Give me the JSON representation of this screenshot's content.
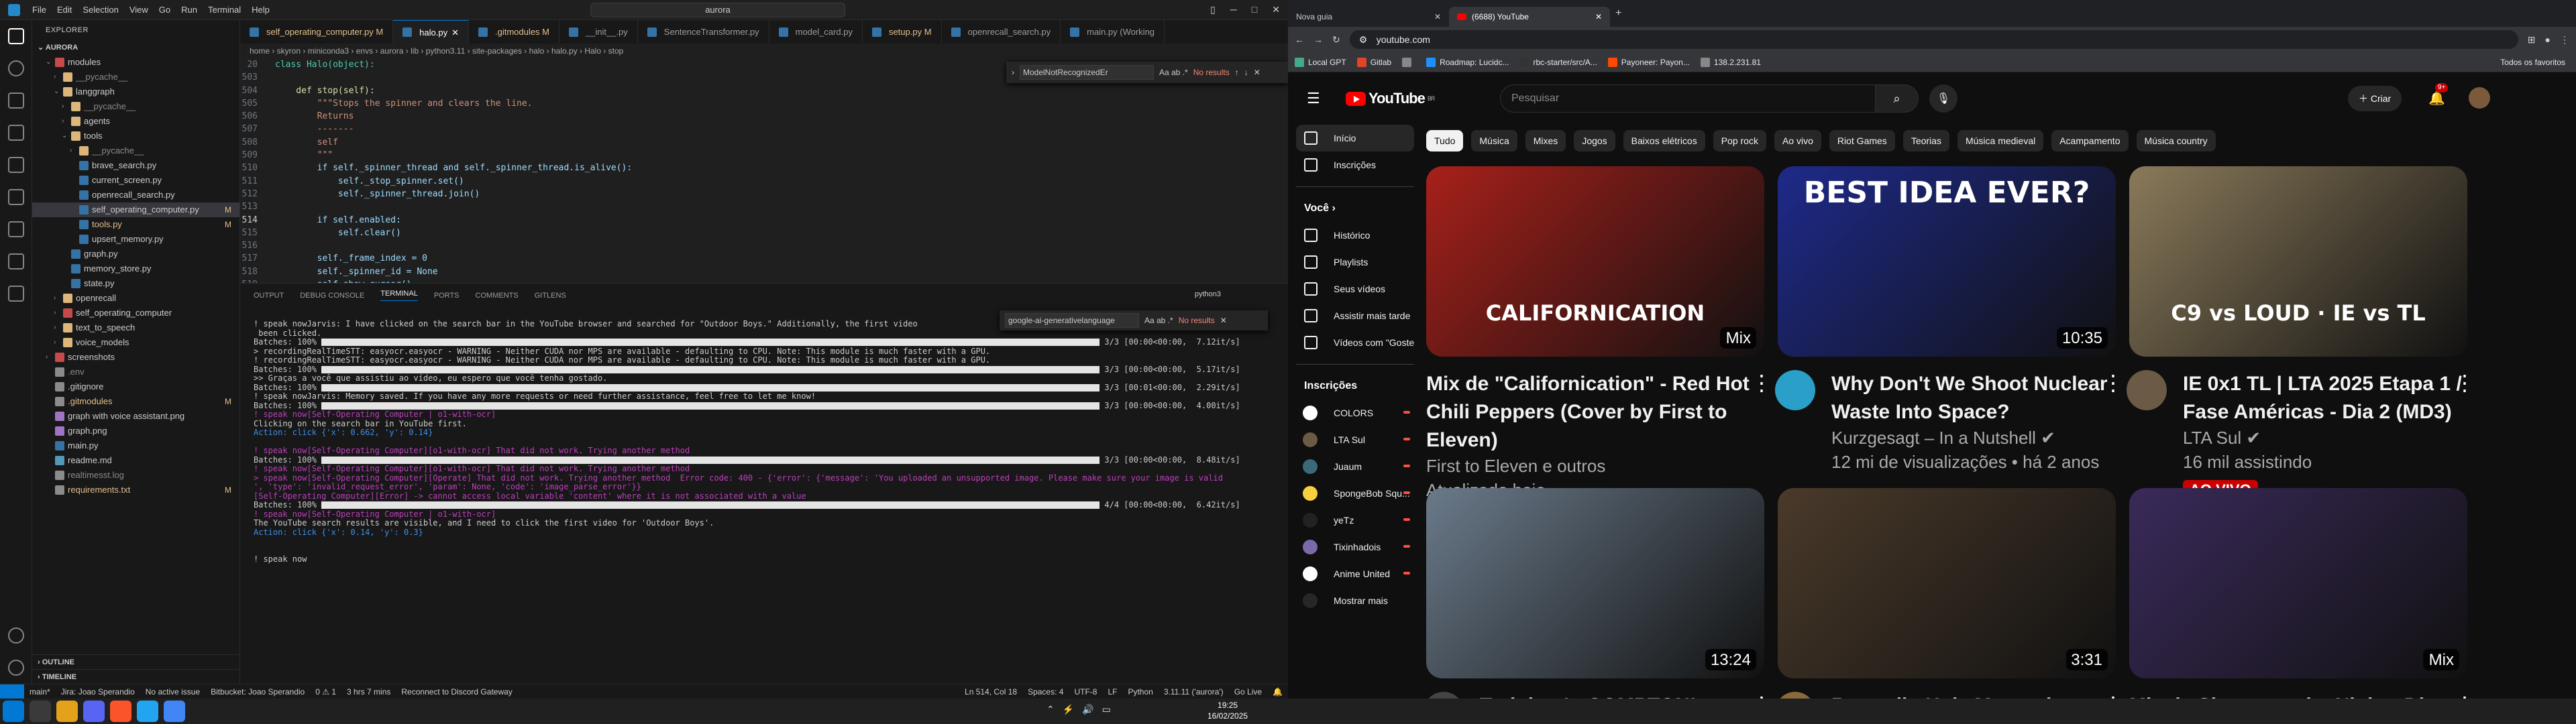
{
  "vscode": {
    "menu": [
      "File",
      "Edit",
      "Selection",
      "View",
      "Go",
      "Run",
      "Terminal",
      "Help"
    ],
    "command_center": "aurora",
    "explorer_title": "EXPLORER",
    "root": "AURORA",
    "tree": [
      {
        "label": "modules",
        "indent": 1,
        "type": "folder-open",
        "color": "red"
      },
      {
        "label": "__pycache__",
        "indent": 2,
        "type": "folder",
        "dim": true
      },
      {
        "label": "langgraph",
        "indent": 2,
        "type": "folder-open"
      },
      {
        "label": "__pycache__",
        "indent": 3,
        "type": "folder",
        "dim": true
      },
      {
        "label": "agents",
        "indent": 3,
        "type": "folder"
      },
      {
        "label": "tools",
        "indent": 3,
        "type": "folder-open"
      },
      {
        "label": "__pycache__",
        "indent": 4,
        "type": "folder",
        "dim": true
      },
      {
        "label": "brave_search.py",
        "indent": 4,
        "type": "py"
      },
      {
        "label": "current_screen.py",
        "indent": 4,
        "type": "py"
      },
      {
        "label": "openrecall_search.py",
        "indent": 4,
        "type": "py"
      },
      {
        "label": "self_operating_computer.py",
        "indent": 4,
        "type": "py",
        "sel": true,
        "mark": "M"
      },
      {
        "label": "tools.py",
        "indent": 4,
        "type": "py",
        "mod": true,
        "mark": "M"
      },
      {
        "label": "upsert_memory.py",
        "indent": 4,
        "type": "py"
      },
      {
        "label": "graph.py",
        "indent": 3,
        "type": "py"
      },
      {
        "label": "memory_store.py",
        "indent": 3,
        "type": "py"
      },
      {
        "label": "state.py",
        "indent": 3,
        "type": "py"
      },
      {
        "label": "openrecall",
        "indent": 2,
        "type": "folder"
      },
      {
        "label": "self_operating_computer",
        "indent": 2,
        "type": "folder",
        "color": "red"
      },
      {
        "label": "text_to_speech",
        "indent": 2,
        "type": "folder"
      },
      {
        "label": "voice_models",
        "indent": 2,
        "type": "folder"
      },
      {
        "label": "screenshots",
        "indent": 1,
        "type": "folder",
        "color": "red"
      },
      {
        "label": ".env",
        "indent": 1,
        "type": "file",
        "dim": true
      },
      {
        "label": ".gitignore",
        "indent": 1,
        "type": "file"
      },
      {
        "label": ".gitmodules",
        "indent": 1,
        "type": "file",
        "mod": true,
        "mark": "M"
      },
      {
        "label": "graph with voice assistant.png",
        "indent": 1,
        "type": "img"
      },
      {
        "label": "graph.png",
        "indent": 1,
        "type": "img"
      },
      {
        "label": "main.py",
        "indent": 1,
        "type": "py"
      },
      {
        "label": "readme.md",
        "indent": 1,
        "type": "md"
      },
      {
        "label": "realtimesst.log",
        "indent": 1,
        "type": "file",
        "dim": true
      },
      {
        "label": "requirements.txt",
        "indent": 1,
        "type": "file",
        "mod": true,
        "mark": "M"
      }
    ],
    "outline": "OUTLINE",
    "timeline": "TIMELINE",
    "tabs": [
      {
        "label": "self_operating_computer.py M",
        "mod": true
      },
      {
        "label": "halo.py",
        "active": true
      },
      {
        "label": ".gitmodules M",
        "mod": true
      },
      {
        "label": "__init__.py"
      },
      {
        "label": "SentenceTransformer.py"
      },
      {
        "label": "model_card.py"
      },
      {
        "label": "setup.py M",
        "mod": true
      },
      {
        "label": "openrecall_search.py"
      },
      {
        "label": "main.py (Working"
      }
    ],
    "breadcrumb": "home › skyron › miniconda3 › envs › aurora › lib › python3.11 › site-packages › halo › halo.py › Halo › stop",
    "find_value": "ModelNotRecognizedEr",
    "find_result": "No results",
    "term_find_value": "google-ai-generativelanguage",
    "term_find_result": "No results",
    "panel_tabs": [
      "OUTPUT",
      "DEBUG CONSOLE",
      "TERMINAL",
      "PORTS",
      "COMMENTS",
      "GITLENS"
    ],
    "terminal_shell": "python3",
    "status": {
      "branch": "main*",
      "jira": "Jira: Joao Sperandio",
      "issue": "No active issue",
      "bitbucket": "Bitbucket: Joao Sperandio",
      "problems": "0 ⚠ 1",
      "time": "3 hrs 7 mins",
      "discord": "Reconnect to Discord Gateway",
      "position": "Ln 514, Col 18",
      "spaces": "Spaces: 4",
      "encoding": "UTF-8",
      "eol": "LF",
      "lang": "Python",
      "interpreter": "3.11.11 ('aurora')",
      "golive": "Go Live"
    }
  },
  "code": [
    {
      "n": "20",
      "t": "class Halo(object):",
      "k": "cls"
    },
    {
      "n": "503",
      "t": ""
    },
    {
      "n": "504",
      "t": "    def stop(self):",
      "k": "def"
    },
    {
      "n": "505",
      "t": "        \"\"\"Stops the spinner and clears the line.",
      "k": "str"
    },
    {
      "n": "506",
      "t": "        Returns",
      "k": "str"
    },
    {
      "n": "507",
      "t": "        -------",
      "k": "str"
    },
    {
      "n": "508",
      "t": "        self",
      "k": "str"
    },
    {
      "n": "509",
      "t": "        \"\"\"",
      "k": "str"
    },
    {
      "n": "510",
      "t": "        if self._spinner_thread and self._spinner_thread.is_alive():"
    },
    {
      "n": "511",
      "t": "            self._stop_spinner.set()"
    },
    {
      "n": "512",
      "t": "            self._spinner_thread.join()"
    },
    {
      "n": "513",
      "t": ""
    },
    {
      "n": "514",
      "t": "        if self.enabled:",
      "cur": true
    },
    {
      "n": "515",
      "t": "            self.clear()"
    },
    {
      "n": "516",
      "t": ""
    },
    {
      "n": "517",
      "t": "        self._frame_index = 0"
    },
    {
      "n": "518",
      "t": "        self._spinner_id = None"
    },
    {
      "n": "519",
      "t": "        self.show_cursor()"
    }
  ],
  "terminal": [
    {
      "t": "! speak nowJarvis: I have clicked on the search bar in the YouTube browser and searched for \"Outdoor Boys.\" Additionally, the first video"
    },
    {
      "t": " been clicked."
    },
    {
      "t": "Batches: 100%",
      "bar": true,
      "r": "3/3 [00:00<00:00,  7.12it/s]"
    },
    {
      "t": "> recordingRealTimeSTT: easyocr.easyocr - WARNING - Neither CUDA nor MPS are available - defaulting to CPU. Note: This module is much faster with a GPU."
    },
    {
      "t": "! recordingRealTimeSTT: easyocr.easyocr - WARNING - Neither CUDA nor MPS are available - defaulting to CPU. Note: This module is much faster with a GPU."
    },
    {
      "t": "Batches: 100%",
      "bar": true,
      "r": "3/3 [00:00<00:00,  5.17it/s]"
    },
    {
      "t": ">> Graças a você que assistiu ao vídeo, eu espero que você tenha gostado."
    },
    {
      "t": "Batches: 100%",
      "bar": true,
      "r": "3/3 [00:01<00:00,  2.29it/s]"
    },
    {
      "t": "! speak nowJarvis: Memory saved. If you have any more requests or need further assistance, feel free to let me know!"
    },
    {
      "t": "Batches: 100%",
      "bar": true,
      "r": "3/3 [00:00<00:00,  4.00it/s]"
    },
    {
      "t": "! speak now[Self-Operating Computer | o1-with-ocr]",
      "c": "magenta"
    },
    {
      "t": "Clicking on the search bar in YouTube first."
    },
    {
      "t": "Action: click {'x': 0.662, 'y': 0.14}",
      "c": "blue"
    },
    {
      "t": ""
    },
    {
      "t": "! speak now[Self-Operating Computer][o1-with-ocr] That did not work. Trying another method",
      "c": "magenta"
    },
    {
      "t": "Batches: 100%",
      "bar": true,
      "r": "3/3 [00:00<00:00,  8.48it/s]"
    },
    {
      "t": "! speak now[Self-Operating Computer][o1-with-ocr] That did not work. Trying another method",
      "c": "magenta"
    },
    {
      "t": "> speak now[Self-Operating Computer][Operate] That did not work. Trying another method  Error code: 400 - {'error': {'message': 'You uploaded an unsupported image. Please make sure your image is valid",
      "c": "magenta"
    },
    {
      "t": "', 'type': 'invalid_request_error', 'param': None, 'code': 'image_parse_error'}}",
      "c": "magenta"
    },
    {
      "t": "[Self-Operating Computer][Error] -> cannot access local variable 'content' where it is not associated with a value",
      "c": "magenta"
    },
    {
      "t": "Batches: 100%",
      "bar": true,
      "r": "4/4 [00:00<00:00,  6.42it/s]"
    },
    {
      "t": "! speak now[Self-Operating Computer | o1-with-ocr]",
      "c": "magenta"
    },
    {
      "t": "The YouTube search results are visible, and I need to click the first video for 'Outdoor Boys'."
    },
    {
      "t": "Action: click {'x': 0.14, 'y': 0.3}",
      "c": "blue"
    },
    {
      "t": ""
    },
    {
      "t": ""
    },
    {
      "t": "! speak now"
    }
  ],
  "browser": {
    "tabs": [
      {
        "label": "Nova guia"
      },
      {
        "label": "(6688) YouTube",
        "active": true
      }
    ],
    "url": "youtube.com",
    "bookmarks": [
      "Local GPT",
      "Gitlab",
      "",
      "Roadmap: Lucidc...",
      "rbc-starter/src/A...",
      "Payoneer: Payon...",
      "138.2.231.81"
    ],
    "all_bookmarks": "Todos os favoritos"
  },
  "youtube": {
    "logo": "YouTube",
    "region": "BR",
    "search_placeholder": "Pesquisar",
    "create": "Criar",
    "notif_count": "9+",
    "nav": [
      {
        "label": "Início",
        "active": true,
        "icon": "home-icon"
      },
      {
        "label": "Inscrições",
        "icon": "subscriptions-icon"
      }
    ],
    "you_header": "Você ›",
    "you_items": [
      {
        "label": "Histórico",
        "icon": "history-icon"
      },
      {
        "label": "Playlists",
        "icon": "playlists-icon"
      },
      {
        "label": "Seus vídeos",
        "icon": "your-videos-icon"
      },
      {
        "label": "Assistir mais tarde",
        "icon": "watch-later-icon"
      },
      {
        "label": "Vídeos com \"Gostei\"",
        "icon": "liked-icon"
      }
    ],
    "subs_header": "Inscrições",
    "subs": [
      {
        "label": "COLORS",
        "color": "#ffffff"
      },
      {
        "label": "LTA Sul",
        "color": "#6b5a45"
      },
      {
        "label": "Juaum",
        "color": "#3a6a7a"
      },
      {
        "label": "SpongeBob Squ...",
        "color": "#f7d13d"
      },
      {
        "label": "yeTz",
        "color": "#222222"
      },
      {
        "label": "Tixinhadois",
        "color": "#7a6aaa"
      },
      {
        "label": "Anime United",
        "color": "#ffffff"
      },
      {
        "label": "Mostrar mais",
        "color": "#272727"
      }
    ],
    "chips": [
      "Tudo",
      "Música",
      "Mixes",
      "Jogos",
      "Baixos elétricos",
      "Pop rock",
      "Ao vivo",
      "Riot Games",
      "Teorias",
      "Música medieval",
      "Acampamento",
      "Música country"
    ],
    "videos": [
      {
        "title": "Mix de \"Californication\" - Red Hot Chili Peppers (Cover by First to Eleven)",
        "meta1": "First to Eleven e outros",
        "meta2": "Atualizado hoje",
        "badge": "Mix",
        "thumb_text": "CALIFORNICATION",
        "thumb_bg": "#a8201a",
        "avatar": false
      },
      {
        "title": "Why Don't We Shoot Nuclear Waste Into Space?",
        "meta1": "Kurzgesagt – In a Nutshell ✔",
        "meta2": "12 mi de visualizações • há 2 anos",
        "badge": "10:35",
        "thumb_text": "BEST IDEA EVER?",
        "thumb_bg": "#1e2a8a",
        "avatar": true,
        "av_color": "#2aa0c8"
      },
      {
        "title": "IE 0x1 TL | LTA 2025 Etapa 1 / Fase Américas - Dia 2 (MD3)",
        "meta1": "LTA Sul ✔",
        "meta2": "16 mil assistindo",
        "live": "AO VIVO",
        "thumb_text": "C9 vs LOUD · IE vs TL",
        "thumb_bg": "#8a7a5a",
        "avatar": true,
        "av_color": "#6b5a45"
      },
      {
        "title": "Training In COMPTON! *Prison Style",
        "meta1": "",
        "meta2": "",
        "badge": "13:24",
        "thumb_text": "",
        "thumb_bg": "#6a7a8a",
        "avatar": true,
        "av_color": "#444444"
      },
      {
        "title": "Roswell - Holy Mountain (Live Session)",
        "meta1": "",
        "meta2": "",
        "badge": "3:31",
        "thumb_text": "",
        "thumb_bg": "#4a3a2a",
        "avatar": true,
        "av_color": "#8a6a3a"
      },
      {
        "title": "Mix de Shame on the Night - Dio",
        "meta1": "",
        "meta2": "",
        "badge": "Mix",
        "thumb_text": "",
        "thumb_bg": "#3a2a5a",
        "avatar": false
      }
    ]
  },
  "taskbar": {
    "time": "19:25",
    "date": "16/02/2025"
  }
}
